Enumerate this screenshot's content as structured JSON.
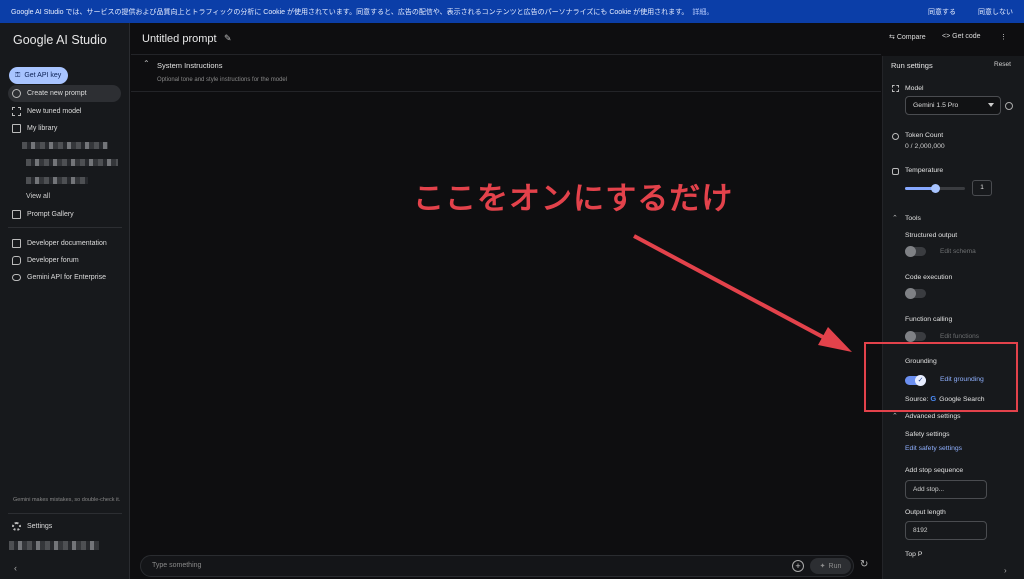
{
  "cookie_banner": {
    "message": "Google AI Studio では、サービスの提供および品質向上とトラフィックの分析に Cookie が使用されています。同意すると、広告の配信や、表示されるコンテンツと広告のパーソナライズにも Cookie が使用されます。",
    "details_link": "詳細。",
    "accept_label": "同意する",
    "decline_label": "同意しない"
  },
  "sidebar": {
    "logo": "Google AI Studio",
    "get_api_key": "Get API key",
    "items": [
      {
        "label": "Create new prompt",
        "icon": "add-circle-icon"
      },
      {
        "label": "New tuned model",
        "icon": "tune-icon"
      },
      {
        "label": "My library",
        "icon": "folder-icon"
      }
    ],
    "view_all": "View all",
    "prompt_gallery": "Prompt Gallery",
    "links": [
      {
        "label": "Developer documentation",
        "icon": "document-icon"
      },
      {
        "label": "Developer forum",
        "icon": "forum-icon"
      },
      {
        "label": "Gemini API for Enterprise",
        "icon": "cloud-icon"
      }
    ],
    "disclaimer": "Gemini makes mistakes, so double-check it.",
    "settings": "Settings"
  },
  "main": {
    "title": "Untitled prompt",
    "compare_label": "Compare",
    "get_code_label": "Get code",
    "system_instructions": {
      "title": "System Instructions",
      "subtitle": "Optional tone and style instructions for the model"
    },
    "prompt_placeholder": "Type something",
    "run_label": "Run"
  },
  "annotation": {
    "text": "ここをオンにするだけ",
    "color": "#e3424b"
  },
  "run_settings": {
    "title": "Run settings",
    "reset_label": "Reset",
    "model_label": "Model",
    "model_value": "Gemini 1.5 Pro",
    "token_count_label": "Token Count",
    "token_count_value": "0 / 2,000,000",
    "temperature_label": "Temperature",
    "temperature_value": "1",
    "temperature_fraction": 0.5,
    "tools_label": "Tools",
    "structured_output": {
      "label": "Structured output",
      "link": "Edit schema",
      "enabled": false
    },
    "code_execution": {
      "label": "Code execution",
      "enabled": false
    },
    "function_calling": {
      "label": "Function calling",
      "link": "Edit functions",
      "enabled": false
    },
    "grounding": {
      "label": "Grounding",
      "link": "Edit grounding",
      "enabled": true,
      "source_label": "Source:",
      "source_value": "Google Search"
    },
    "advanced_settings_label": "Advanced settings",
    "safety_settings_label": "Safety settings",
    "edit_safety_label": "Edit safety settings",
    "stop_sequence_label": "Add stop sequence",
    "stop_sequence_placeholder": "Add stop...",
    "output_length_label": "Output length",
    "output_length_value": "8192",
    "top_p_label": "Top P"
  }
}
